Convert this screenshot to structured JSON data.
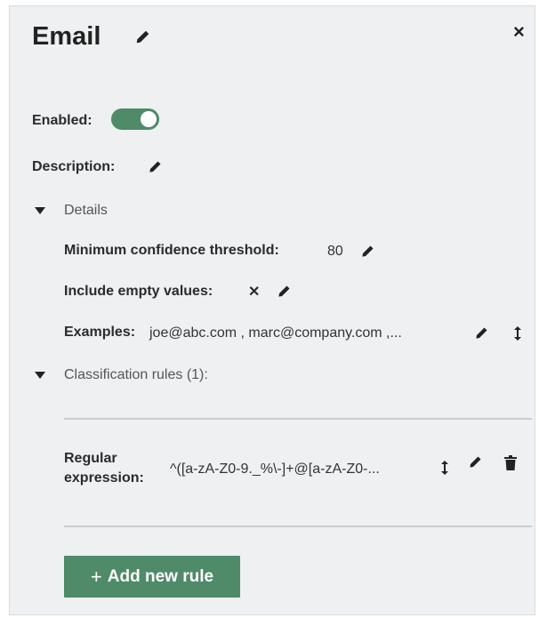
{
  "header": {
    "title": "Email",
    "close_glyph": "×"
  },
  "enabled": {
    "label": "Enabled:",
    "value": true
  },
  "description": {
    "label": "Description:"
  },
  "details": {
    "label": "Details",
    "min_confidence": {
      "label": "Minimum confidence threshold:",
      "value": "80"
    },
    "include_empty": {
      "label": "Include empty values:",
      "value_glyph": "✕"
    },
    "examples": {
      "label": "Examples:",
      "value": "joe@abc.com , marc@company.com ,..."
    }
  },
  "rules": {
    "label": "Classification rules (1):",
    "items": [
      {
        "type_line1": "Regular",
        "type_line2": "expression:",
        "pattern": "^([a-zA-Z0-9._%\\-]+@[a-zA-Z0-..."
      }
    ]
  },
  "add_rule_button": {
    "plus": "+",
    "label": "Add new rule"
  },
  "colors": {
    "accent": "#4f8a69",
    "panel": "#eef0f1"
  },
  "icons": [
    "pencil-icon",
    "close-icon",
    "caret-down-icon",
    "sort-icon",
    "trash-icon"
  ]
}
